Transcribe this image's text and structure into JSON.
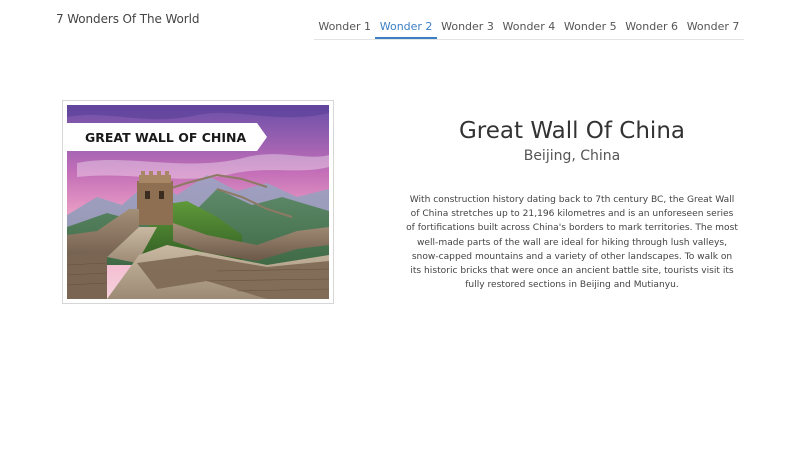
{
  "header": {
    "brand": "7 Wonders Of The World"
  },
  "tabs": [
    {
      "label": "Wonder 1",
      "active": false
    },
    {
      "label": "Wonder 2",
      "active": true
    },
    {
      "label": "Wonder 3",
      "active": false
    },
    {
      "label": "Wonder 4",
      "active": false
    },
    {
      "label": "Wonder 5",
      "active": false
    },
    {
      "label": "Wonder 6",
      "active": false
    },
    {
      "label": "Wonder 7",
      "active": false
    }
  ],
  "wonder": {
    "image_banner": "GREAT WALL OF CHINA",
    "title": "Great Wall Of China",
    "location": "Beijing, China",
    "description": "With construction history dating back to 7th century BC, the Great Wall of China stretches up to 21,196 kilometres and is an unforeseen series of fortifications built across China's borders to mark territories. The most well-made parts of the wall are ideal for hiking through lush valleys, snow-capped mountains and a variety of other landscapes. To walk on its historic bricks that were once an ancient battle site, tourists visit its fully restored sections in Beijing and Mutianyu."
  },
  "colors": {
    "accent": "#3d7fc4",
    "text": "#333333",
    "tab_border": "#e3e3e3"
  }
}
